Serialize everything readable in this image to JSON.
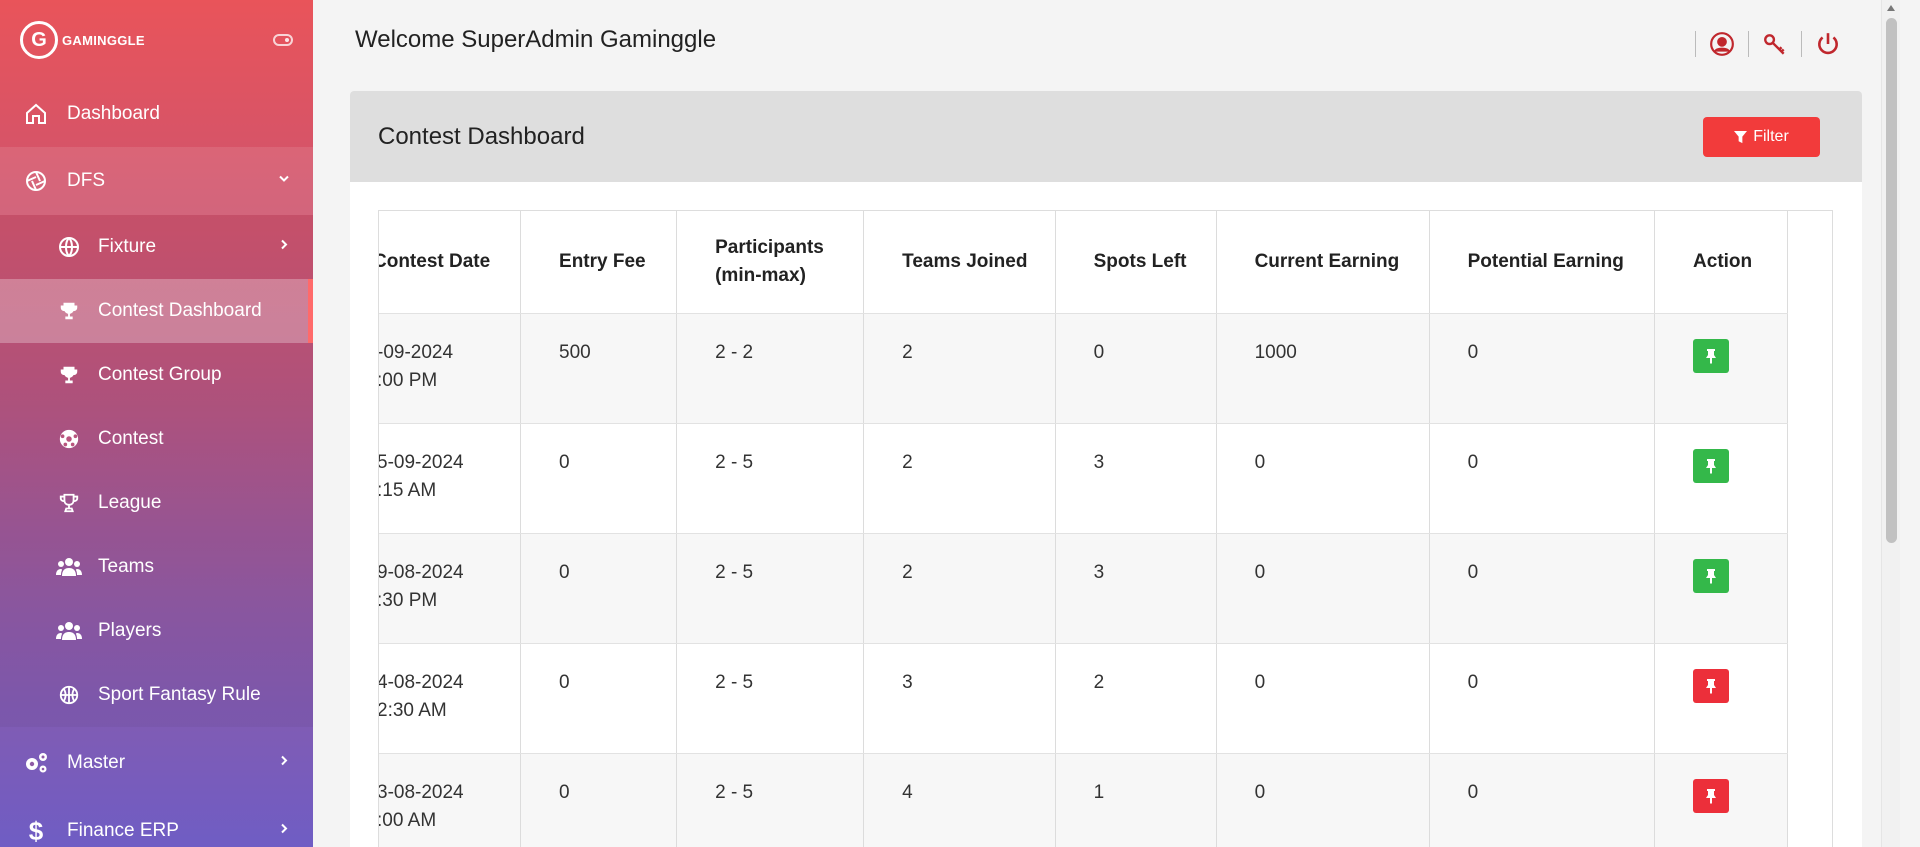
{
  "brand": {
    "logo_letter": "G",
    "name": "GAMINGGLE"
  },
  "sidebar": {
    "dashboard": "Dashboard",
    "dfs": "DFS",
    "sub_items": [
      {
        "label": "Fixture",
        "icon": "globe-icon",
        "has_chevron": true
      },
      {
        "label": "Contest Dashboard",
        "icon": "trophy-icon",
        "active": true
      },
      {
        "label": "Contest Group",
        "icon": "trophy-icon"
      },
      {
        "label": "Contest",
        "icon": "soccer-ball-icon"
      },
      {
        "label": "League",
        "icon": "trophy-outline-icon"
      },
      {
        "label": "Teams",
        "icon": "users-icon"
      },
      {
        "label": "Players",
        "icon": "users-icon"
      },
      {
        "label": "Sport Fantasy Rule",
        "icon": "basketball-icon"
      }
    ],
    "master": "Master",
    "finance": "Finance ERP"
  },
  "header": {
    "welcome": "Welcome SuperAdmin Gaminggle"
  },
  "card": {
    "title": "Contest Dashboard",
    "filter_label": "Filter"
  },
  "table": {
    "headers": {
      "date": "Contest Date",
      "fee": "Entry Fee",
      "participants_l1": "Participants",
      "participants_l2": "(min-max)",
      "teams": "Teams Joined",
      "spots": "Spots Left",
      "current": "Current Earning",
      "potential": "Potential Earning",
      "action": "Action"
    },
    "rows": [
      {
        "date": "-09-2024",
        "time": ":00 PM",
        "fee": "500",
        "participants": "2 - 2",
        "teams": "2",
        "spots": "0",
        "current": "1000",
        "potential": "0",
        "pin": "green"
      },
      {
        "date": "5-09-2024",
        "time": ":15 AM",
        "fee": "0",
        "participants": "2 - 5",
        "teams": "2",
        "spots": "3",
        "current": "0",
        "potential": "0",
        "pin": "green"
      },
      {
        "date": "9-08-2024",
        "time": ":30 PM",
        "fee": "0",
        "participants": "2 - 5",
        "teams": "2",
        "spots": "3",
        "current": "0",
        "potential": "0",
        "pin": "green"
      },
      {
        "date": "4-08-2024",
        "time": "2:30 AM",
        "fee": "0",
        "participants": "2 - 5",
        "teams": "3",
        "spots": "2",
        "current": "0",
        "potential": "0",
        "pin": "red"
      },
      {
        "date": "3-08-2024",
        "time": ":00 AM",
        "fee": "0",
        "participants": "2 - 5",
        "teams": "4",
        "spots": "1",
        "current": "0",
        "potential": "0",
        "pin": "red"
      }
    ]
  },
  "colors": {
    "accent": "#f23b3b",
    "pin_green": "#34b84a",
    "pin_red": "#ec2f3a"
  }
}
